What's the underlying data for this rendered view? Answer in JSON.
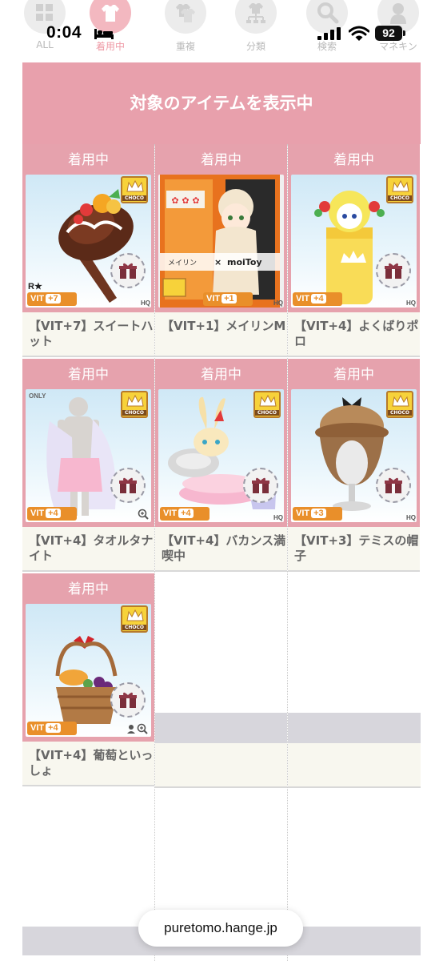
{
  "status_bar": {
    "time": "0:04",
    "battery": "92"
  },
  "nav": [
    {
      "label": "ALL",
      "icon": "grid-icon",
      "active": false
    },
    {
      "label": "着用中",
      "icon": "shirt-icon",
      "active": true
    },
    {
      "label": "重複",
      "icon": "duplicate-shirts-icon",
      "active": false
    },
    {
      "label": "分類",
      "icon": "category-tree-icon",
      "active": false
    },
    {
      "label": "検索",
      "icon": "search-icon",
      "active": false
    },
    {
      "label": "マネキン",
      "icon": "mannequin-icon",
      "active": false
    }
  ],
  "banner": "対象のアイテムを表示中",
  "items": [
    {
      "tag": "着用中",
      "name": "【VIT+7】スイートハット",
      "vit": "+7",
      "rarity": "R★",
      "art": "chocolate-hat"
    },
    {
      "tag": "着用中",
      "name": "【VIT+1】メイリンM",
      "vit": "+1",
      "art": "meirin-collab"
    },
    {
      "tag": "着用中",
      "name": "【VIT+4】よくばりポロ",
      "vit": "+4",
      "art": "yokubari-polo"
    },
    {
      "tag": "着用中",
      "name": "【VIT+4】タオルタナイト",
      "vit": "+4",
      "only": "ONLY",
      "art": "towel-night"
    },
    {
      "tag": "着用中",
      "name": "【VIT+4】バカンス満喫中",
      "vit": "+4",
      "art": "vacation-bunny"
    },
    {
      "tag": "着用中",
      "name": "【VIT+3】テミスの帽子",
      "vit": "+3",
      "art": "themis-hat"
    },
    {
      "tag": "着用中",
      "name": "【VIT+4】葡萄といっしょ",
      "vit": "+4",
      "art": "grape-basket"
    }
  ],
  "labels": {
    "vit": "VIT",
    "choco": "CHOCO",
    "hq": "HQ",
    "moitoy": "moiToy",
    "meirin": "メイリン"
  },
  "url": "puretomo.hange.jp",
  "colors": {
    "accent_pink": "#e6a2ad",
    "vit_orange": "#e98f2a",
    "choco_gold": "#f7d23a"
  }
}
